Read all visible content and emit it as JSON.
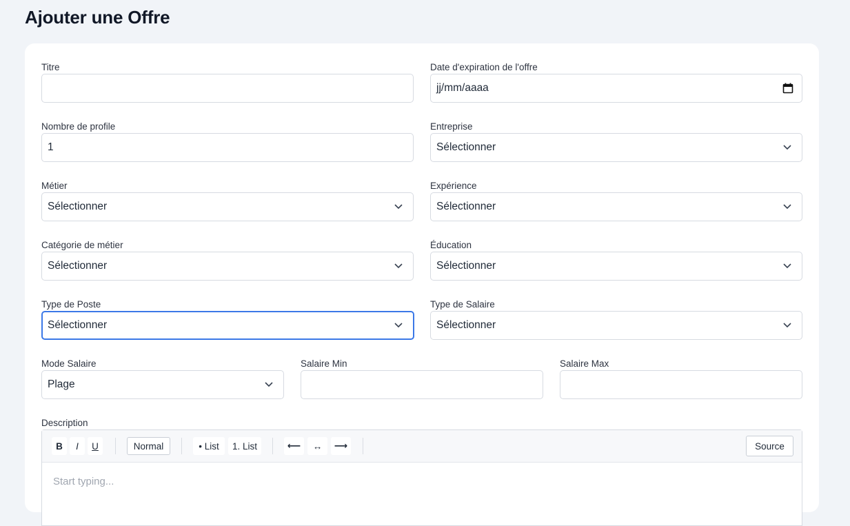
{
  "page": {
    "title": "Ajouter une Offre"
  },
  "form": {
    "titre": {
      "label": "Titre",
      "value": ""
    },
    "date_expiration": {
      "label": "Date d'expiration de l'offre",
      "value": "jj/mm/aaaa",
      "icon": "calendar-icon"
    },
    "nombre_profile": {
      "label": "Nombre de profile",
      "value": "1"
    },
    "entreprise": {
      "label": "Entreprise",
      "value": "Sélectionner"
    },
    "metier": {
      "label": "Métier",
      "value": "Sélectionner"
    },
    "experience": {
      "label": "Expérience",
      "value": "Sélectionner"
    },
    "categorie_metier": {
      "label": "Catégorie de métier",
      "value": "Sélectionner"
    },
    "education": {
      "label": "Éducation",
      "value": "Sélectionner"
    },
    "type_poste": {
      "label": "Type de Poste",
      "value": "Sélectionner",
      "focused": true
    },
    "type_salaire": {
      "label": "Type de Salaire",
      "value": "Sélectionner"
    },
    "mode_salaire": {
      "label": "Mode Salaire",
      "value": "Plage"
    },
    "salaire_min": {
      "label": "Salaire Min",
      "value": ""
    },
    "salaire_max": {
      "label": "Salaire Max",
      "value": ""
    },
    "description": {
      "label": "Description",
      "placeholder": "Start typing...",
      "toolbar": {
        "bold": "B",
        "italic": "I",
        "underline": "U",
        "format": "Normal",
        "bullet_list": "• List",
        "ordered_list": "1. List",
        "align_left": "⟵",
        "align_center": "↔",
        "align_right": "⟶",
        "source": "Source"
      }
    }
  },
  "colors": {
    "focus": "#3b78e7",
    "background": "#f1f4f8",
    "card": "#ffffff"
  }
}
